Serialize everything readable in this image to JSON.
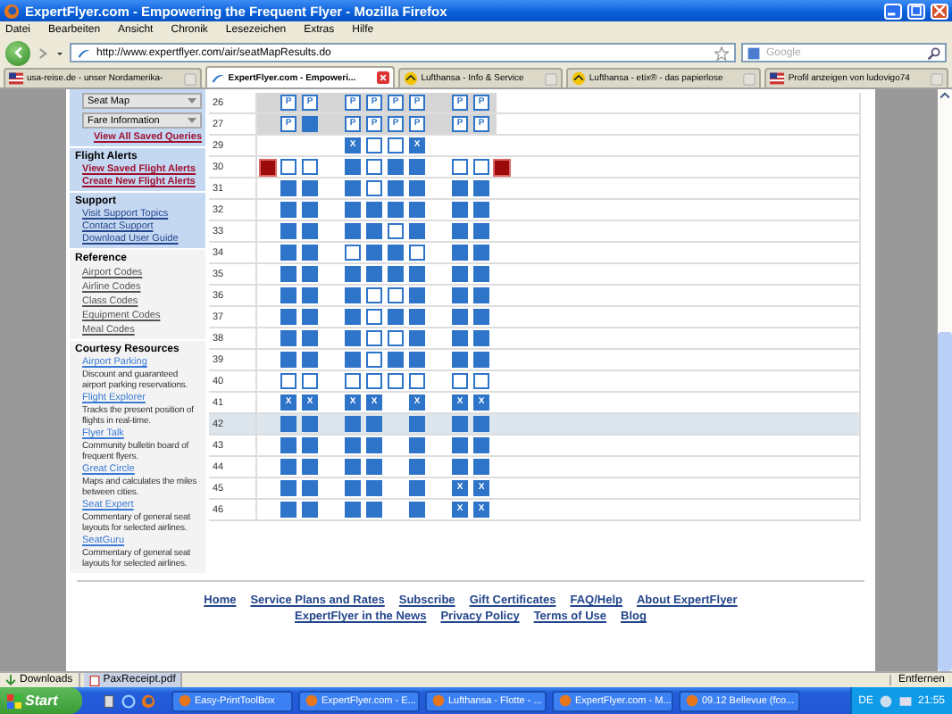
{
  "window": {
    "title": "ExpertFlyer.com - Empowering the Frequent Flyer - Mozilla Firefox",
    "menu": [
      "Datei",
      "Bearbeiten",
      "Ansicht",
      "Chronik",
      "Lesezeichen",
      "Extras",
      "Hilfe"
    ]
  },
  "navigation": {
    "url": "http://www.expertflyer.com/air/seatMapResults.do",
    "search_placeholder": "Google"
  },
  "tabs": [
    {
      "label": "usa-reise.de - unser Nordamerika-",
      "selected": false
    },
    {
      "label": "ExpertFlyer.com - Empoweri...",
      "selected": true
    },
    {
      "label": "Lufthansa - Info & Service",
      "selected": false
    },
    {
      "label": "Lufthansa - etix® - das papierlose",
      "selected": false
    },
    {
      "label": "Profil anzeigen von ludovigo74",
      "selected": false
    }
  ],
  "sidebar": {
    "selects": [
      "Seat Map",
      "Fare Information"
    ],
    "saved_link": "View All Saved Queries",
    "sections": [
      {
        "kind": "alerts",
        "title": "Flight Alerts",
        "links": [
          "View Saved Flight Alerts",
          "Create New Flight Alerts"
        ]
      },
      {
        "kind": "support",
        "title": "Support",
        "links": [
          "Visit Support Topics",
          "Contact Support",
          "Download User Guide"
        ]
      },
      {
        "kind": "reference",
        "title": "Reference",
        "links": [
          "Airport Codes",
          "Airline Codes",
          "Class Codes",
          "Equipment Codes",
          "Meal Codes"
        ]
      },
      {
        "kind": "resources",
        "title": "Courtesy Resources",
        "items": [
          {
            "name": "Airport Parking",
            "description": "Discount and guaranteed airport parking reservations."
          },
          {
            "name": "Flight Explorer",
            "description": "Tracks the present position of flights in real-time."
          },
          {
            "name": "Flyer Talk",
            "description": "Community bulletin board of frequent flyers."
          },
          {
            "name": "Great Circle",
            "description": "Maps and calculates the miles between cities."
          },
          {
            "name": "Seat Expert",
            "description": "Commentary of general seat layouts for selected airlines."
          },
          {
            "name": "SeatGuru",
            "description": "Commentary of general seat layouts for selected airlines."
          }
        ]
      }
    ]
  },
  "seat_map": {
    "rows": [
      {
        "number": "26",
        "shaded": true,
        "highlighted": false,
        "exits": false,
        "seats": [
          {
            "kind": "marked",
            "label": "P"
          },
          {
            "kind": "marked",
            "label": "P"
          },
          {
            "kind": "marked",
            "label": "P"
          },
          {
            "kind": "marked",
            "label": "P"
          },
          {
            "kind": "marked",
            "label": "P"
          },
          {
            "kind": "marked",
            "label": "P"
          },
          {
            "kind": "marked",
            "label": "P"
          },
          {
            "kind": "marked",
            "label": "P"
          }
        ]
      },
      {
        "number": "27",
        "shaded": true,
        "highlighted": false,
        "exits": false,
        "seats": [
          {
            "kind": "marked",
            "label": "P"
          },
          {
            "kind": "occupied"
          },
          {
            "kind": "marked",
            "label": "P"
          },
          {
            "kind": "marked",
            "label": "P"
          },
          {
            "kind": "marked",
            "label": "P"
          },
          {
            "kind": "marked",
            "label": "P"
          },
          {
            "kind": "marked",
            "label": "P"
          },
          {
            "kind": "marked",
            "label": "P"
          }
        ]
      },
      {
        "number": "29",
        "shaded": false,
        "highlighted": false,
        "exits": false,
        "seats": [
          {
            "kind": "none"
          },
          {
            "kind": "none"
          },
          {
            "kind": "blocked",
            "label": "X"
          },
          {
            "kind": "open"
          },
          {
            "kind": "open"
          },
          {
            "kind": "blocked",
            "label": "X"
          },
          {
            "kind": "none"
          },
          {
            "kind": "none"
          }
        ]
      },
      {
        "number": "30",
        "shaded": false,
        "highlighted": false,
        "exits": true,
        "seats": [
          {
            "kind": "open"
          },
          {
            "kind": "open"
          },
          {
            "kind": "occupied"
          },
          {
            "kind": "open"
          },
          {
            "kind": "occupied"
          },
          {
            "kind": "occupied"
          },
          {
            "kind": "open"
          },
          {
            "kind": "open"
          }
        ]
      },
      {
        "number": "31",
        "shaded": false,
        "highlighted": false,
        "exits": false,
        "seats": [
          {
            "kind": "occupied"
          },
          {
            "kind": "occupied"
          },
          {
            "kind": "occupied"
          },
          {
            "kind": "open"
          },
          {
            "kind": "occupied"
          },
          {
            "kind": "occupied"
          },
          {
            "kind": "occupied"
          },
          {
            "kind": "occupied"
          }
        ]
      },
      {
        "number": "32",
        "shaded": false,
        "highlighted": false,
        "exits": false,
        "seats": [
          {
            "kind": "occupied"
          },
          {
            "kind": "occupied"
          },
          {
            "kind": "occupied"
          },
          {
            "kind": "occupied"
          },
          {
            "kind": "occupied"
          },
          {
            "kind": "occupied"
          },
          {
            "kind": "occupied"
          },
          {
            "kind": "occupied"
          }
        ]
      },
      {
        "number": "33",
        "shaded": false,
        "highlighted": false,
        "exits": false,
        "seats": [
          {
            "kind": "occupied"
          },
          {
            "kind": "occupied"
          },
          {
            "kind": "occupied"
          },
          {
            "kind": "occupied"
          },
          {
            "kind": "open"
          },
          {
            "kind": "occupied"
          },
          {
            "kind": "occupied"
          },
          {
            "kind": "occupied"
          }
        ]
      },
      {
        "number": "34",
        "shaded": false,
        "highlighted": false,
        "exits": false,
        "seats": [
          {
            "kind": "occupied"
          },
          {
            "kind": "occupied"
          },
          {
            "kind": "open"
          },
          {
            "kind": "occupied"
          },
          {
            "kind": "occupied"
          },
          {
            "kind": "open"
          },
          {
            "kind": "occupied"
          },
          {
            "kind": "occupied"
          }
        ]
      },
      {
        "number": "35",
        "shaded": false,
        "highlighted": false,
        "exits": false,
        "seats": [
          {
            "kind": "occupied"
          },
          {
            "kind": "occupied"
          },
          {
            "kind": "occupied"
          },
          {
            "kind": "occupied"
          },
          {
            "kind": "occupied"
          },
          {
            "kind": "occupied"
          },
          {
            "kind": "occupied"
          },
          {
            "kind": "occupied"
          }
        ]
      },
      {
        "number": "36",
        "shaded": false,
        "highlighted": false,
        "exits": false,
        "seats": [
          {
            "kind": "occupied"
          },
          {
            "kind": "occupied"
          },
          {
            "kind": "occupied"
          },
          {
            "kind": "open"
          },
          {
            "kind": "open"
          },
          {
            "kind": "occupied"
          },
          {
            "kind": "occupied"
          },
          {
            "kind": "occupied"
          }
        ]
      },
      {
        "number": "37",
        "shaded": false,
        "highlighted": false,
        "exits": false,
        "seats": [
          {
            "kind": "occupied"
          },
          {
            "kind": "occupied"
          },
          {
            "kind": "occupied"
          },
          {
            "kind": "open"
          },
          {
            "kind": "occupied"
          },
          {
            "kind": "occupied"
          },
          {
            "kind": "occupied"
          },
          {
            "kind": "occupied"
          }
        ]
      },
      {
        "number": "38",
        "shaded": false,
        "highlighted": false,
        "exits": false,
        "seats": [
          {
            "kind": "occupied"
          },
          {
            "kind": "occupied"
          },
          {
            "kind": "occupied"
          },
          {
            "kind": "open"
          },
          {
            "kind": "open"
          },
          {
            "kind": "occupied"
          },
          {
            "kind": "occupied"
          },
          {
            "kind": "occupied"
          }
        ]
      },
      {
        "number": "39",
        "shaded": false,
        "highlighted": false,
        "exits": false,
        "seats": [
          {
            "kind": "occupied"
          },
          {
            "kind": "occupied"
          },
          {
            "kind": "occupied"
          },
          {
            "kind": "open"
          },
          {
            "kind": "occupied"
          },
          {
            "kind": "occupied"
          },
          {
            "kind": "occupied"
          },
          {
            "kind": "occupied"
          }
        ]
      },
      {
        "number": "40",
        "shaded": false,
        "highlighted": false,
        "exits": false,
        "seats": [
          {
            "kind": "open"
          },
          {
            "kind": "open"
          },
          {
            "kind": "open"
          },
          {
            "kind": "open"
          },
          {
            "kind": "open"
          },
          {
            "kind": "open"
          },
          {
            "kind": "open"
          },
          {
            "kind": "open"
          }
        ]
      },
      {
        "number": "41",
        "shaded": false,
        "highlighted": false,
        "exits": false,
        "seats": [
          {
            "kind": "blocked",
            "label": "X"
          },
          {
            "kind": "blocked",
            "label": "X"
          },
          {
            "kind": "blocked",
            "label": "X"
          },
          {
            "kind": "blocked",
            "label": "X"
          },
          {
            "kind": "none"
          },
          {
            "kind": "blocked",
            "label": "X"
          },
          {
            "kind": "blocked",
            "label": "X"
          },
          {
            "kind": "blocked",
            "label": "X"
          }
        ]
      },
      {
        "number": "42",
        "shaded": false,
        "highlighted": true,
        "exits": false,
        "seats": [
          {
            "kind": "occupied"
          },
          {
            "kind": "occupied"
          },
          {
            "kind": "occupied"
          },
          {
            "kind": "occupied"
          },
          {
            "kind": "none"
          },
          {
            "kind": "occupied"
          },
          {
            "kind": "occupied"
          },
          {
            "kind": "occupied"
          }
        ]
      },
      {
        "number": "43",
        "shaded": false,
        "highlighted": false,
        "exits": false,
        "seats": [
          {
            "kind": "occupied"
          },
          {
            "kind": "occupied"
          },
          {
            "kind": "occupied"
          },
          {
            "kind": "occupied"
          },
          {
            "kind": "none"
          },
          {
            "kind": "occupied"
          },
          {
            "kind": "occupied"
          },
          {
            "kind": "occupied"
          }
        ]
      },
      {
        "number": "44",
        "shaded": false,
        "highlighted": false,
        "exits": false,
        "seats": [
          {
            "kind": "occupied"
          },
          {
            "kind": "occupied"
          },
          {
            "kind": "occupied"
          },
          {
            "kind": "occupied"
          },
          {
            "kind": "none"
          },
          {
            "kind": "occupied"
          },
          {
            "kind": "occupied"
          },
          {
            "kind": "occupied"
          }
        ]
      },
      {
        "number": "45",
        "shaded": false,
        "highlighted": false,
        "exits": false,
        "seats": [
          {
            "kind": "occupied"
          },
          {
            "kind": "occupied"
          },
          {
            "kind": "occupied"
          },
          {
            "kind": "occupied"
          },
          {
            "kind": "none"
          },
          {
            "kind": "occupied"
          },
          {
            "kind": "blocked",
            "label": "X"
          },
          {
            "kind": "blocked",
            "label": "X"
          }
        ]
      },
      {
        "number": "46",
        "shaded": false,
        "highlighted": false,
        "exits": false,
        "seats": [
          {
            "kind": "occupied"
          },
          {
            "kind": "occupied"
          },
          {
            "kind": "occupied"
          },
          {
            "kind": "occupied"
          },
          {
            "kind": "none"
          },
          {
            "kind": "occupied"
          },
          {
            "kind": "blocked",
            "label": "X"
          },
          {
            "kind": "blocked",
            "label": "X"
          }
        ]
      }
    ]
  },
  "footer_links": [
    [
      "Home",
      "Service Plans and Rates",
      "Subscribe",
      "Gift Certificates",
      "FAQ/Help",
      "About ExpertFlyer"
    ],
    [
      "ExpertFlyer in the News",
      "Privacy Policy",
      "Terms of Use",
      "Blog"
    ]
  ],
  "downloads": {
    "label": "Downloads",
    "file": "PaxReceipt.pdf",
    "clear": "Entfernen"
  },
  "taskbar": {
    "start": "Start",
    "tasks": [
      "Easy-PrintToolBox",
      "ExpertFlyer.com - E...",
      "Lufthansa - Flotte - ...",
      "ExpertFlyer.com - M...",
      "09.12 Bellevue (fco..."
    ],
    "language": "DE",
    "time": "21:55"
  }
}
